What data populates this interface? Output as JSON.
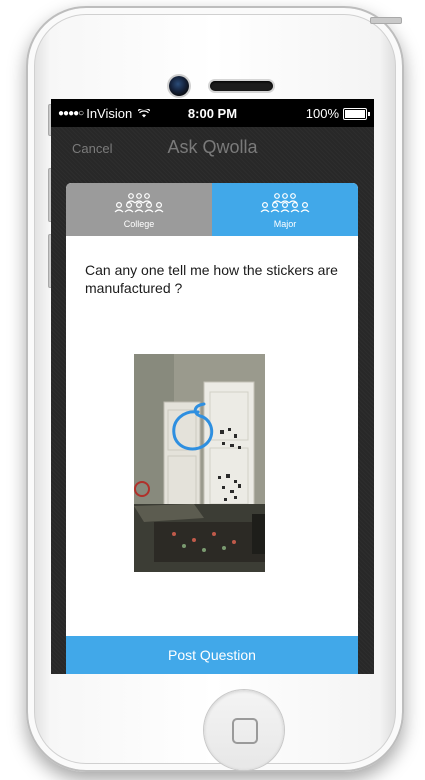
{
  "status_bar": {
    "signal_dots": "●●●●○",
    "carrier": "InVision",
    "time": "8:00 PM",
    "battery": "100%"
  },
  "nav": {
    "cancel_label": "Cancel",
    "title": "Ask Qwolla"
  },
  "tabs": [
    {
      "label": "College",
      "icon": "group-icon",
      "selected": false
    },
    {
      "label": "Major",
      "icon": "group-icon",
      "selected": true
    }
  ],
  "question_text": "Can any one tell me how the stickers are manufactured ?",
  "attached_photo": {
    "description_icon": "photo"
  },
  "post_button_label": "Post Question",
  "colors": {
    "accent": "#41a8e9",
    "tab_inactive": "#9b9b9b",
    "screen_bg": "#282828",
    "status_bar": "#000000"
  }
}
